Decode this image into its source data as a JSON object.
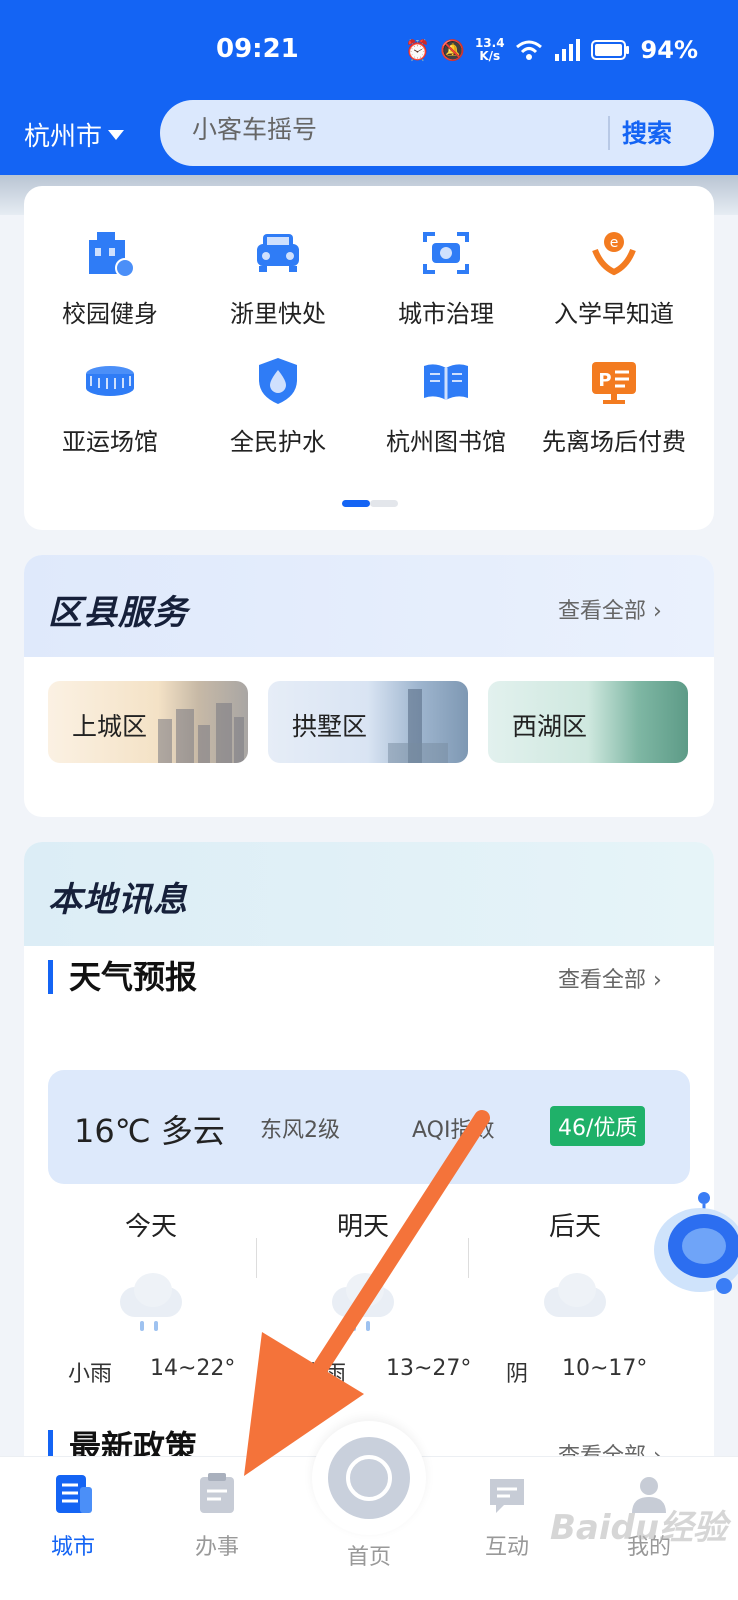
{
  "status_bar": {
    "time": "09:21",
    "net_speed_value": "13.4",
    "net_speed_unit": "K/s",
    "battery": "94%"
  },
  "header": {
    "city": "杭州市",
    "search_placeholder": "小客车摇号",
    "search_button": "搜索"
  },
  "services": [
    {
      "label": "校园健身",
      "icon": "school-fitness-icon",
      "color": "#2f7cf6"
    },
    {
      "label": "浙里快处",
      "icon": "car-accident-icon",
      "color": "#2f7cf6"
    },
    {
      "label": "城市治理",
      "icon": "camera-scan-icon",
      "color": "#2f7cf6"
    },
    {
      "label": "入学早知道",
      "icon": "student-icon",
      "color": "#f37b20"
    },
    {
      "label": "亚运场馆",
      "icon": "stadium-icon",
      "color": "#2f7cf6"
    },
    {
      "label": "全民护水",
      "icon": "water-shield-icon",
      "color": "#2f7cf6"
    },
    {
      "label": "杭州图书馆",
      "icon": "book-icon",
      "color": "#2f7cf6"
    },
    {
      "label": "先离场后付费",
      "icon": "parking-screen-icon",
      "color": "#f37b20"
    }
  ],
  "district": {
    "title": "区县服务",
    "view_all": "查看全部",
    "items": [
      "上城区",
      "拱墅区",
      "西湖区"
    ]
  },
  "local": {
    "title": "本地讯息",
    "weather_title": "天气预报",
    "view_all": "查看全部",
    "current": {
      "temp": "16℃ 多云",
      "wind": "东风2级",
      "aqi_label": "AQI指数",
      "aqi_value": "46/优质"
    },
    "days": [
      {
        "name": "今天",
        "desc": "小雨",
        "range": "14~22°"
      },
      {
        "name": "明天",
        "desc": "中到大雨",
        "range": "13~27°"
      },
      {
        "name": "后天",
        "desc": "阴",
        "range": "10~17°"
      }
    ],
    "policy_title": "最新政策",
    "policy_view_all": "查看全部"
  },
  "bottom_nav": [
    {
      "label": "城市",
      "icon": "city-icon"
    },
    {
      "label": "办事",
      "icon": "clipboard-icon"
    },
    {
      "label": "首页",
      "icon": "home-logo-icon"
    },
    {
      "label": "互动",
      "icon": "chat-icon"
    },
    {
      "label": "我的",
      "icon": "user-icon"
    }
  ],
  "watermark": "Baidu经验",
  "colors": {
    "primary": "#1464f4",
    "accent": "#f37b20",
    "aqi_good": "#1fb169"
  }
}
